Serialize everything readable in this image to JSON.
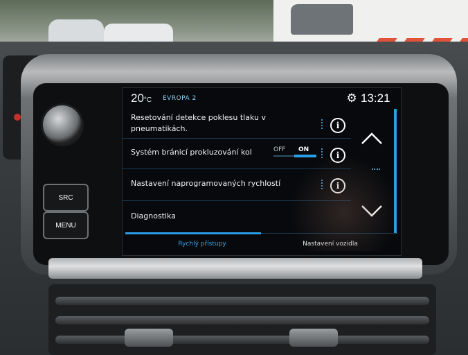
{
  "status": {
    "temperature": "20",
    "temperature_unit": "°C",
    "radio_station": "EVROPA 2",
    "time": "13:21"
  },
  "hardware": {
    "src_label": "SRC",
    "menu_label": "MENU"
  },
  "settings": {
    "items": [
      {
        "label": "Resetování detekce poklesu tlaku v pneumatikách."
      },
      {
        "label": "Systém bránicí prokluzování kol",
        "toggle_off": "OFF",
        "toggle_on": "ON",
        "toggle_state": "ON"
      },
      {
        "label": "Nastavení naprogramovaných rychlostí"
      },
      {
        "label": "Diagnostika"
      }
    ]
  },
  "tabs": {
    "quick_access": "Rychlý přístupy",
    "vehicle_settings": "Nastavení vozidla"
  },
  "colors": {
    "accent": "#2a9ee6",
    "text": "#f1f3f5",
    "station": "#8fd2f6"
  },
  "icons": [
    "gear-icon",
    "info-icon",
    "chevron-up-icon",
    "chevron-down-icon"
  ]
}
